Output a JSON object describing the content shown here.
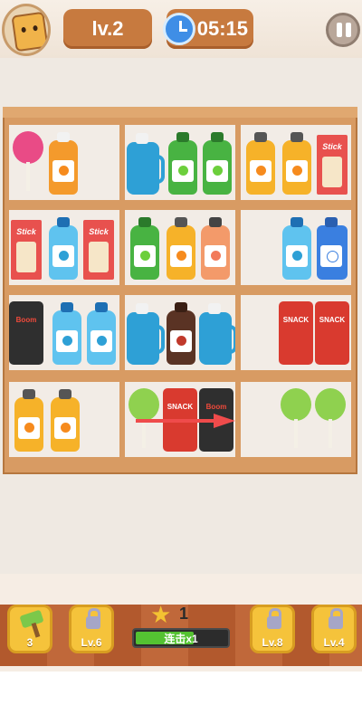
{
  "header": {
    "level": "lv.2",
    "timer": "05:15"
  },
  "shelf": {
    "cells": [
      {
        "items": [
          "lollipop-pink",
          "orange-bottle"
        ]
      },
      {
        "items": [
          "blue-jug",
          "apple-bottle",
          "apple-bottle"
        ]
      },
      {
        "items": [
          "orange-bottle",
          "orange-bottle",
          "stick-box"
        ]
      },
      {
        "items": [
          "stick-box",
          "blue-bottle",
          "stick-box"
        ]
      },
      {
        "items": [
          "apple-bottle",
          "orange-bottle",
          "peach-bottle"
        ]
      },
      {
        "items": [
          "blue-bottle",
          "rabbit-can"
        ]
      },
      {
        "items": [
          "boom-bag",
          "blue-bottle",
          "blue-bottle"
        ]
      },
      {
        "items": [
          "blue-jug",
          "cola-bottle",
          "blue-jug"
        ]
      },
      {
        "items": [
          "snack-bag",
          "snack-bag"
        ]
      },
      {
        "items": [
          "orange-bottle",
          "orange-bottle"
        ]
      },
      {
        "items": [
          "lollipop-green",
          "snack-bag",
          "boom-bag"
        ]
      },
      {
        "items": [
          "lollipop-green",
          "lollipop-green"
        ]
      }
    ],
    "labels": {
      "stick": "Stick",
      "snack": "SNACK",
      "boom": "Boom"
    }
  },
  "bottom": {
    "tools": [
      {
        "name": "hammer",
        "label": "3"
      },
      {
        "name": "locked",
        "label": "Lv.6"
      },
      {
        "name": "locked",
        "label": "Lv.8"
      },
      {
        "name": "locked",
        "label": "Lv.4"
      }
    ],
    "stars": "1",
    "combo_label": "连击x1",
    "combo_progress": 0.62
  },
  "colors": {
    "pill": "#c77a3f",
    "shelf": "#d89b63",
    "tool": "#f5c33b",
    "combo_fill": "#54c232"
  }
}
